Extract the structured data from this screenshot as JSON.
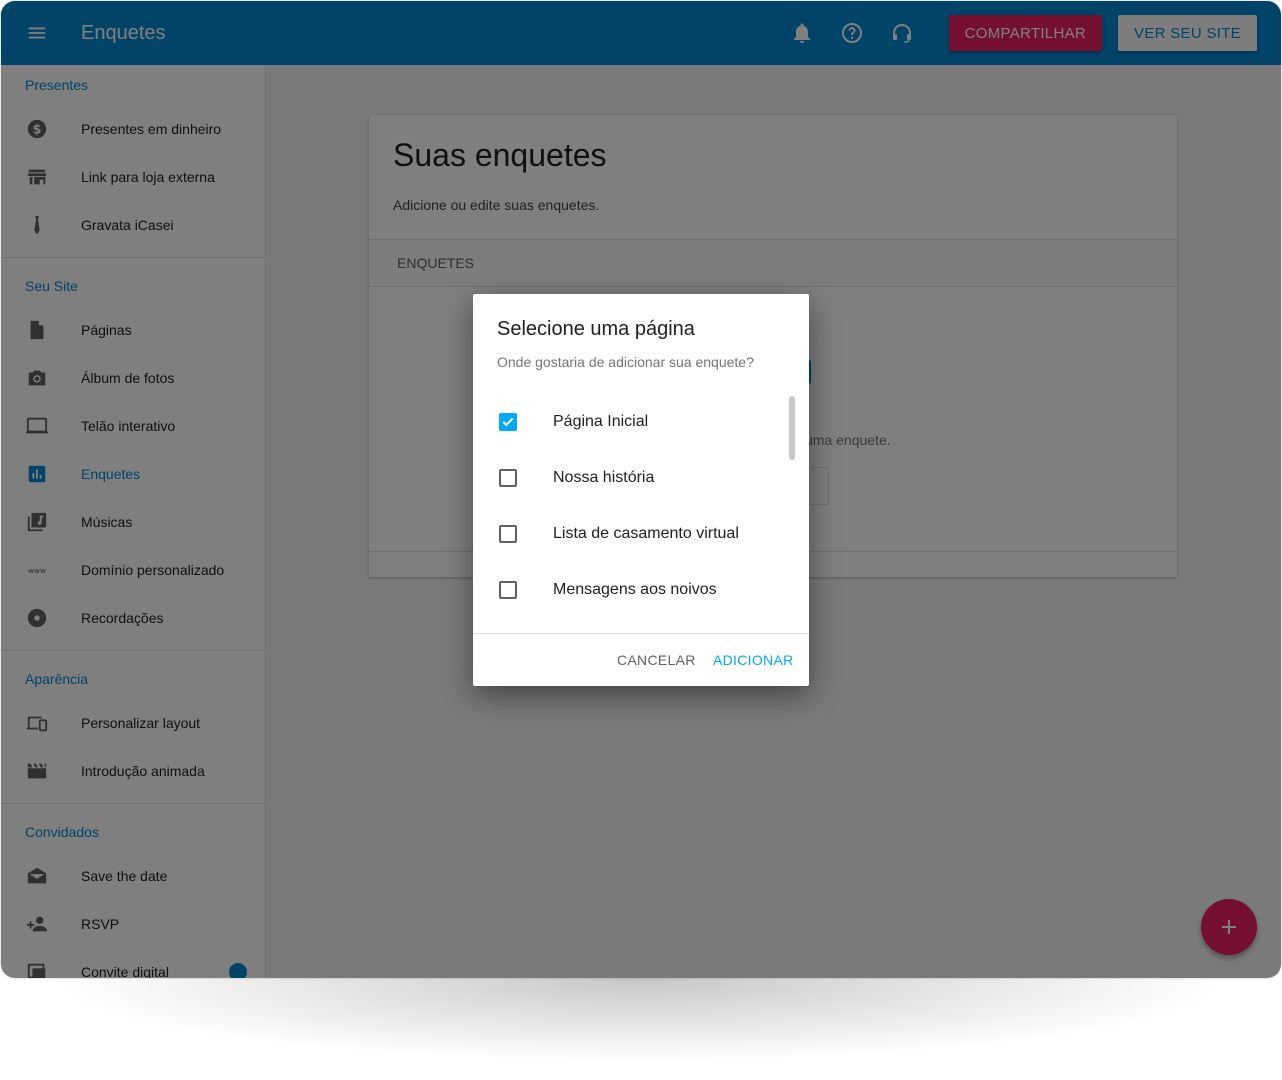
{
  "appbar": {
    "title": "Enquetes",
    "share_label": "COMPARTILHAR",
    "site_label": "VER SEU SITE",
    "color": "#0288d1",
    "share_color": "#e91e63"
  },
  "sidebar": {
    "sections": [
      {
        "title": "Presentes",
        "items": [
          {
            "label": "Presentes em dinheiro",
            "icon": "dollar-circle-icon"
          },
          {
            "label": "Link para loja externa",
            "icon": "store-icon"
          },
          {
            "label": "Gravata iCasei",
            "icon": "tie-icon"
          }
        ]
      },
      {
        "title": "Seu Site",
        "items": [
          {
            "label": "Páginas",
            "icon": "page-icon"
          },
          {
            "label": "Álbum de fotos",
            "icon": "camera-icon"
          },
          {
            "label": "Telão interativo",
            "icon": "screen-icon"
          },
          {
            "label": "Enquetes",
            "icon": "poll-icon",
            "active": true
          },
          {
            "label": "Músicas",
            "icon": "music-library-icon"
          },
          {
            "label": "Domínio personalizado",
            "icon": "www-icon"
          },
          {
            "label": "Recordações",
            "icon": "disc-icon"
          }
        ]
      },
      {
        "title": "Aparência",
        "items": [
          {
            "label": "Personalizar layout",
            "icon": "devices-icon"
          },
          {
            "label": "Introdução animada",
            "icon": "clapperboard-icon"
          }
        ]
      },
      {
        "title": "Convidados",
        "items": [
          {
            "label": "Save the date",
            "icon": "envelope-open-icon"
          },
          {
            "label": "RSVP",
            "icon": "add-person-icon"
          },
          {
            "label": "Convite digital",
            "icon": "invite-icon"
          }
        ]
      }
    ]
  },
  "main": {
    "card_title": "Suas enquetes",
    "card_subtitle": "Adicione ou edite suas enquetes.",
    "table_header": "ENQUETES",
    "empty_text_fragment": "uma enquete."
  },
  "dialog": {
    "title": "Selecione uma página",
    "subtitle": "Onde gostaria de adicionar sua enquete?",
    "options": [
      {
        "label": "Página Inicial",
        "checked": true
      },
      {
        "label": "Nossa história",
        "checked": false
      },
      {
        "label": "Lista de casamento virtual",
        "checked": false
      },
      {
        "label": "Mensagens aos noivos",
        "checked": false
      }
    ],
    "cancel_label": "CANCELAR",
    "add_label": "ADICIONAR",
    "accent": "#03a9f4"
  }
}
